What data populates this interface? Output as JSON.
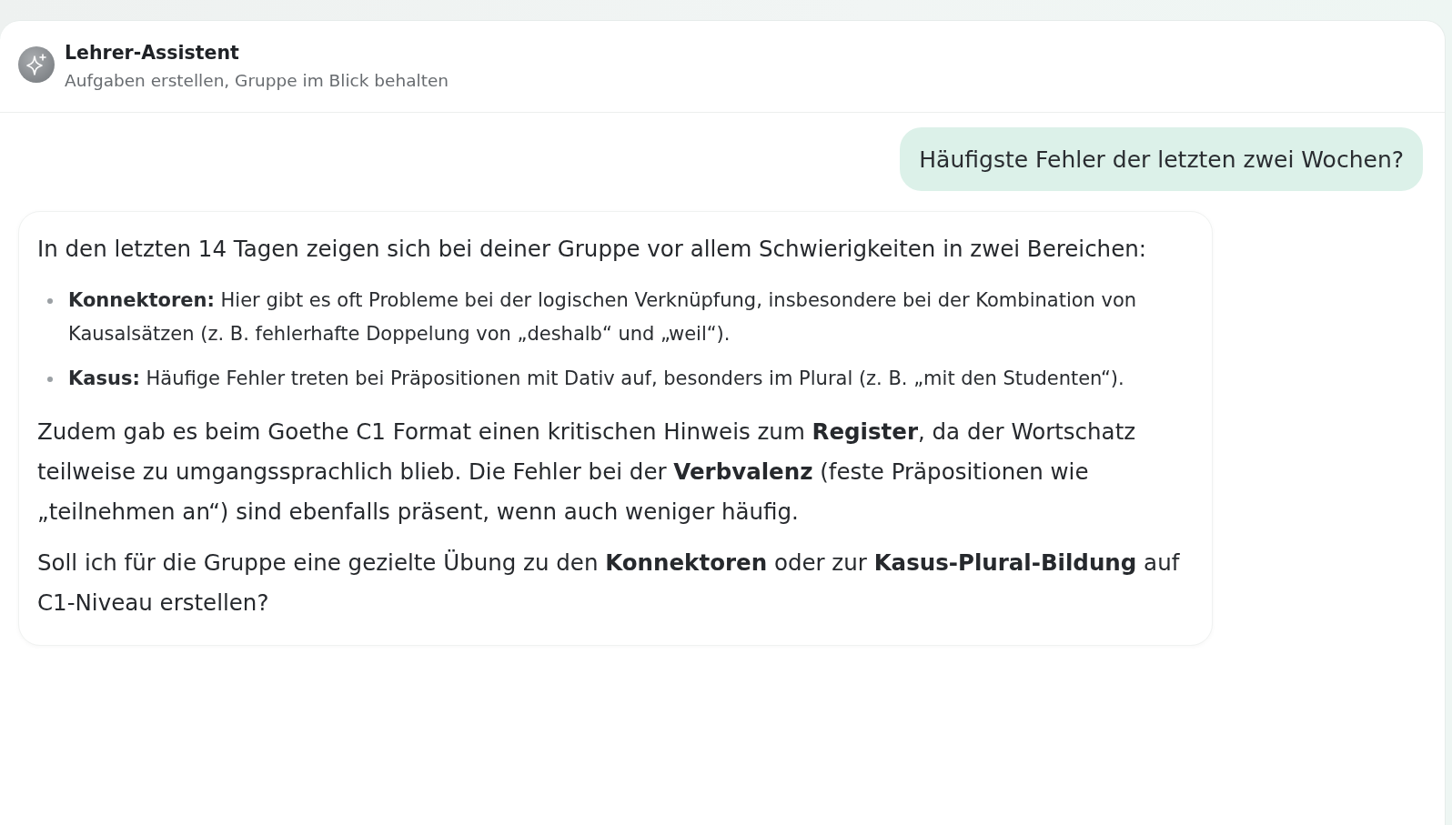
{
  "header": {
    "title": "Lehrer-Assistent",
    "subtitle": "Aufgaben erstellen, Gruppe im Blick behalten"
  },
  "messages": [
    {
      "kind": "user",
      "text": "Häufigste Fehler der letzten zwei Wochen?"
    },
    {
      "kind": "assistant",
      "blocks": [
        {
          "kind": "paragraph",
          "text": "In den letzten 14 Tagen zeigen sich bei deiner Gruppe vor allem Schwierigkeiten in zwei Bereichen:"
        },
        {
          "kind": "list",
          "items": [
            "**Konnektoren:** Hier gibt es oft Probleme bei der logischen Verknüpfung, insbesondere bei der Kombination von Kausalsätzen (z. B. fehlerhafte Doppelung von „deshalb“ und „weil“).",
            "**Kasus:** Häufige Fehler treten bei Präpositionen mit Dativ auf, besonders im Plural (z. B. „mit den Studenten“)."
          ]
        },
        {
          "kind": "paragraph",
          "text": "Zudem gab es beim Goethe C1 Format einen kritischen Hinweis zum **Register**, da der Wortschatz teilweise zu umgangssprachlich blieb. Die Fehler bei der **Verbvalenz** (feste Präpositionen wie „teilnehmen an“) sind ebenfalls präsent, wenn auch weniger häufig."
        },
        {
          "kind": "paragraph",
          "text": "Soll ich für die Gruppe eine gezielte Übung zu den **Konnektoren** oder zur **Kasus-Plural-Bildung** auf C1-Niveau erstellen?"
        }
      ]
    }
  ]
}
